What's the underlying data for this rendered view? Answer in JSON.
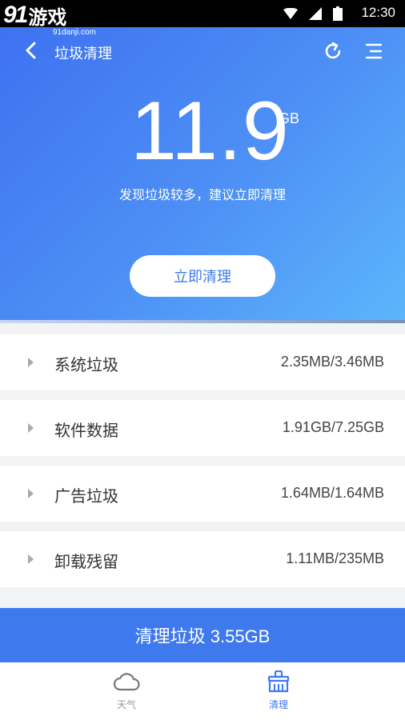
{
  "watermark": {
    "logo": "91",
    "name": "游戏",
    "site": "91danji.com"
  },
  "status": {
    "time": "12:30"
  },
  "nav": {
    "title": "垃圾清理",
    "back_icon": "chevron-left-icon",
    "refresh_icon": "refresh-icon",
    "menu_icon": "menu-icon"
  },
  "summary": {
    "value": "11.9",
    "unit": "GB",
    "hint": "发现垃圾较多，建议立即清理",
    "clean_label": "立即清理"
  },
  "items": [
    {
      "label": "系统垃圾",
      "value": "2.35MB/3.46MB"
    },
    {
      "label": "软件数据",
      "value": "1.91GB/7.25GB"
    },
    {
      "label": "广告垃圾",
      "value": "1.64MB/1.64MB"
    },
    {
      "label": "卸载残留",
      "value": "1.11MB/235MB"
    }
  ],
  "bottom_action": {
    "label": "清理垃圾 3.55GB"
  },
  "tabs": [
    {
      "label": "天气",
      "icon": "cloud-icon",
      "color": "#999999"
    },
    {
      "label": "清理",
      "icon": "broom-icon",
      "color": "#3f79ee"
    }
  ],
  "colors": {
    "accent": "#3f79ee",
    "gradient_start": "#3d6ff0",
    "gradient_end": "#5cb6fb"
  }
}
